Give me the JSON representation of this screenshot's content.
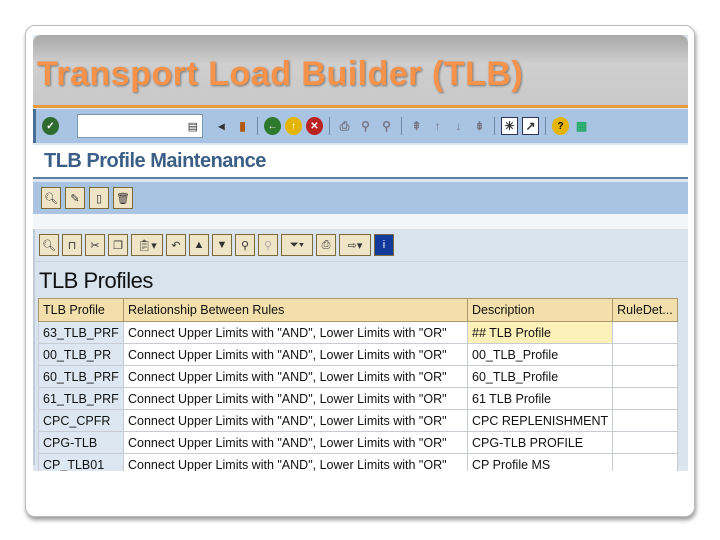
{
  "slide_title": "Transport Load Builder (TLB)",
  "screen_title": "TLB Profile Maintenance",
  "grid_title": "TLB Profiles",
  "columns": [
    "TLB Profile",
    "Relationship Between Rules",
    "Description",
    "RuleDet..."
  ],
  "rows": [
    {
      "profile": "63_TLB_PRF",
      "rel": "Connect Upper Limits with \"AND\", Lower Limits with \"OR\"",
      "desc": "## TLB Profile",
      "rule": ""
    },
    {
      "profile": "00_TLB_PR",
      "rel": "Connect Upper Limits with \"AND\", Lower Limits with \"OR\"",
      "desc": "00_TLB_Profile",
      "rule": ""
    },
    {
      "profile": "60_TLB_PRF",
      "rel": "Connect Upper Limits with \"AND\", Lower Limits with \"OR\"",
      "desc": "60_TLB_Profile",
      "rule": ""
    },
    {
      "profile": "61_TLB_PRF",
      "rel": "Connect Upper Limits with \"AND\", Lower Limits with \"OR\"",
      "desc": "61 TLB Profile",
      "rule": ""
    },
    {
      "profile": "CPC_CPFR",
      "rel": "Connect Upper Limits with \"AND\", Lower Limits with \"OR\"",
      "desc": "CPC REPLENISHMENT",
      "rule": ""
    },
    {
      "profile": "CPG-TLB",
      "rel": "Connect Upper Limits with \"AND\", Lower Limits with \"OR\"",
      "desc": "CPG-TLB PROFILE",
      "rule": ""
    },
    {
      "profile": "CP_TLB01",
      "rel": "Connect Upper Limits with \"AND\", Lower Limits with \"OR\"",
      "desc": "CP Profile MS",
      "rule": ""
    }
  ],
  "command_field": {
    "value": ""
  }
}
